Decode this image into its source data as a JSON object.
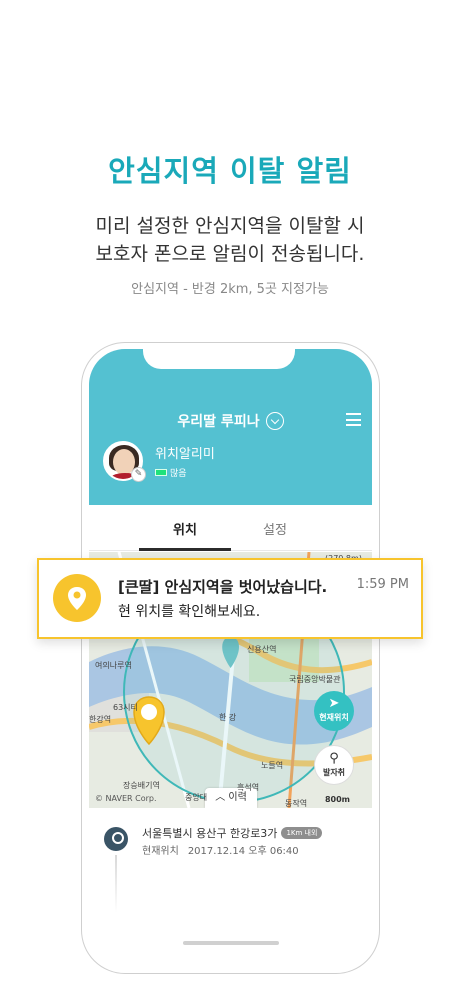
{
  "promo": {
    "title": "안심지역 이탈 알림",
    "line1": "미리 설정한 안심지역을 이탈할 시",
    "line2": "보호자 폰으로 알림이 전송됩니다.",
    "note": "안심지역 - 반경 2km, 5곳 지정가능"
  },
  "app": {
    "header_title": "우리딸 루피나",
    "location_name": "위치알리미",
    "battery_label": "많음",
    "tabs": [
      {
        "label": "위치"
      },
      {
        "label": "설정"
      }
    ],
    "map": {
      "attribution": "© NAVER Corp.",
      "history_label": "이력",
      "scale_label": "800m",
      "current_location_label": "현재위치",
      "departure_label": "발자취",
      "place_labels": [
        "여의나루역",
        "63시티",
        "한강역",
        "장승배기역",
        "신용산역",
        "국립중앙박물관",
        "한 강",
        "노들역",
        "흑석역",
        "중앙대",
        "동작역",
        "(270.8m)"
      ]
    },
    "bottom": {
      "address": "서울특별시 용산구 한강로3가",
      "radius_badge": "1Km 내외",
      "status": "현재위치",
      "timestamp": "2017.12.14 오후 06:40"
    }
  },
  "notification": {
    "title": "[큰딸] 안심지역을 벗어났습니다.",
    "time": "1:59 PM",
    "body": "현 위치를 확인해보세요."
  },
  "colors": {
    "accent": "#1aa9b9",
    "header": "#54c1d1",
    "notification_border": "#f7c42d"
  }
}
